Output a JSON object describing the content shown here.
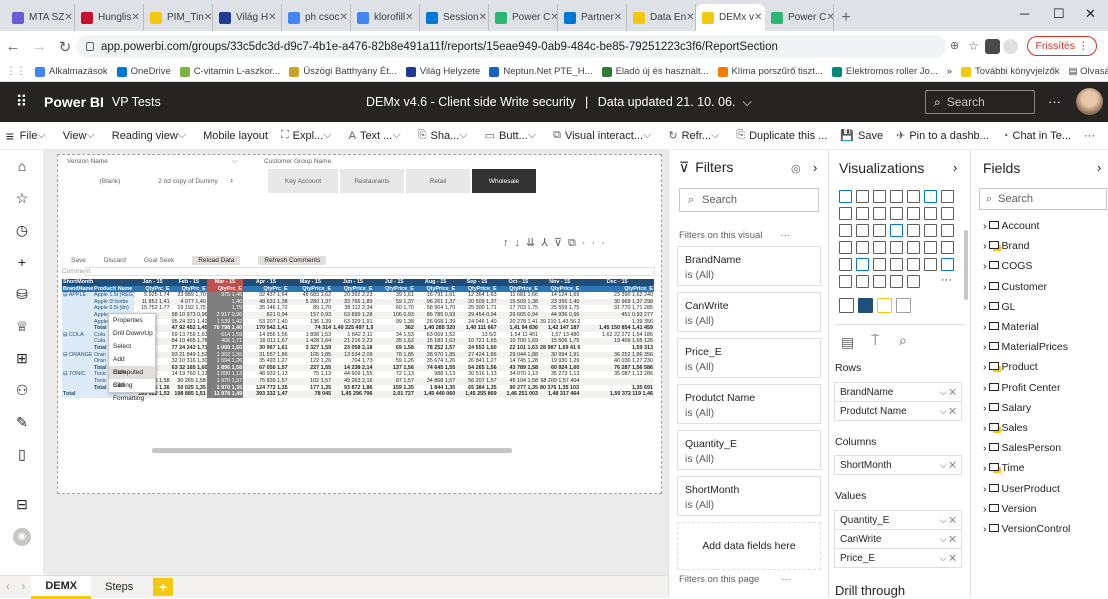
{
  "browser": {
    "tabs": [
      {
        "label": "MTA SZ",
        "color": "#6b5bd6"
      },
      {
        "label": "Hunglis",
        "color": "#c8102e"
      },
      {
        "label": "PIM_Tin",
        "color": "#f2c811"
      },
      {
        "label": "Világ H",
        "color": "#1f3a93"
      },
      {
        "label": "ph csoc",
        "color": "#4285f4"
      },
      {
        "label": "klorofill",
        "color": "#4285f4"
      },
      {
        "label": "Session",
        "color": "#0078d4"
      },
      {
        "label": "Power C",
        "color": "#2bb673"
      },
      {
        "label": "Partner",
        "color": "#0078d4"
      },
      {
        "label": "Data En",
        "color": "#f2c811"
      },
      {
        "label": "DEMx v",
        "color": "#f2c811",
        "active": true
      },
      {
        "label": "Power C",
        "color": "#2bb673"
      }
    ],
    "url": "app.powerbi.com/groups/33c5dc3d-d9c7-4b1e-a476-82b8e491a11f/reports/15eae949-0ab9-484c-be85-79251223c3f6/ReportSection",
    "refresh_label": "Frissítés",
    "bookmarks": [
      {
        "label": "Alkalmazások",
        "color": "#4285f4"
      },
      {
        "label": "OneDrive",
        "color": "#0078d4"
      },
      {
        "label": "C-vitamin L-aszkor...",
        "color": "#7cb342"
      },
      {
        "label": "Üszögi Batthyány Ét...",
        "color": "#c9a227"
      },
      {
        "label": "Világ Helyzete",
        "color": "#1f3a93"
      },
      {
        "label": "Neptun.Net PTE_H...",
        "color": "#1565c0"
      },
      {
        "label": "Eladó új és használt...",
        "color": "#2e7d32"
      },
      {
        "label": "Klíma porszűrő tiszt...",
        "color": "#f57c00"
      },
      {
        "label": "Elektromos roller Jo...",
        "color": "#00897b"
      }
    ],
    "bookmarks_more": "»",
    "other_bookmarks": "További könyvjelzők",
    "reading_list": "Olvasási lista"
  },
  "pbi": {
    "app_name": "Power BI",
    "workspace": "VP Tests",
    "report_title": "DEMx v4.6 - Client side Write security",
    "separator": "|",
    "updated": "Data updated 21. 10. 06.",
    "search_placeholder": "Search",
    "more": "···"
  },
  "toolbar": [
    "File",
    "View",
    "Reading view",
    "Mobile layout",
    "Expl...",
    "Text ...",
    "Sha...",
    "Butt...",
    "Visual interact...",
    "Refr...",
    "Duplicate this ...",
    "Save",
    "Pin to a dashb...",
    "Chat in Te...",
    "···"
  ],
  "slicers": {
    "version_label": "Version Name",
    "version_items": [
      "(Blank)",
      "2 nd copy of Dummy"
    ],
    "customer_label": "Customer Group Name",
    "customer_items": [
      "Key Account",
      "Restaurants",
      "Retail",
      "Wholesale"
    ]
  },
  "matrix_toolbar": {
    "buttons": [
      "Save",
      "Discard",
      "Goal Seek",
      "Reload Data",
      "Refresh Comments"
    ],
    "comment": "Comment"
  },
  "matrix": {
    "col_header_row1": [
      "ShortMonth",
      "Jan - 15",
      "Feb - 15",
      "Mar - 15",
      "Apr - 15",
      "May - 15",
      "Jun - 15",
      "Jul - 15",
      "Aug - 15",
      "Sep - 15",
      "Oct - 15",
      "Nov - 15",
      "Dec - 15"
    ],
    "col_header_row2": [
      "BrandName",
      "Productt Name",
      "QtyPrc_E",
      "QtyPrc_E",
      "QtyPrc_E",
      "QtyPrc_E",
      "QtyPrice_E",
      "QtyPrice_E",
      "QtyPrice_E",
      "QtyPrice_E",
      "QtyPrice_E",
      "QtyPrice_E",
      "QtyPrice_E",
      "QtyPrice_E"
    ],
    "rows": [
      [
        "APPLE",
        "Apple 1.5l (REG)",
        "5 925 1,74",
        "33 889 1,70",
        "975 1,46",
        "32 437 1,64",
        "48 683 1,62",
        "20 392 2,23",
        "39 1,61",
        "16 791 1,61",
        "12 364 1,63",
        "11 681 1,66",
        "14 124 1,69",
        "23 390 1,62 240"
      ],
      [
        "",
        "Apple 0l bottle",
        "11 851 1,41",
        "4 077 1,40",
        "1,40",
        "48 631 1,38",
        "5 280 1,37",
        "33 766 1,89",
        "59 1,37",
        "96 261 1,37",
        "20 509 1,37",
        "15 509 1,38",
        "23 356 1,40",
        "30 969 1,37 298"
      ],
      [
        "",
        "Apple 0.5l (tin)",
        "15 752 1,77",
        "19 192 1,75",
        "1,75",
        "35 146 1,72",
        "89 1,70",
        "38 112 2,34",
        "60 1,70",
        "58 904 1,70",
        "25 300 1,71",
        "17 703 1,75",
        "25 559 1,75",
        "31 770 1,71 285"
      ],
      [
        "",
        "Apple",
        "",
        "98 10 973 0,96",
        "2 917 0,96",
        "821 0,94",
        "157 0,93",
        "63 899 1,28",
        "106 0,93",
        "86 785 0,93",
        "29 454 0,94",
        "29 665 0,94",
        "44 936 0,96",
        "451 0,93 277"
      ],
      [
        "",
        "Apple",
        "",
        "95 24 321 1,42",
        "1 539 1,42",
        "53 207 1,40",
        "136 1,39",
        "63 329 1,91",
        "99 1,38",
        "26 668 1,39",
        "24 046 1,40",
        "20 278 1,41",
        "39 210 1,43 56 274",
        "1,39 356"
      ],
      [
        "",
        "Total",
        "",
        "47 92 452 1,45",
        "70 798 1,40",
        "170 542 1,41",
        "74 314",
        "1,40 225 497 1,93",
        "362",
        "1,40 285 320",
        "1,40 111 667",
        "1,41 94 836",
        "1,42 147 187",
        "1,45 150 854 1,41 459"
      ],
      [
        "COLA",
        "Cola",
        "",
        "69 13 759 1,63",
        "614 1,59",
        "14 956 1,56",
        "1 898 1,53",
        "1 842 2,11",
        "34 1,53",
        "63 069 1,52",
        "13 5/2",
        "1,54 11 401",
        "1,57 13 480",
        "1,62 22 272 1,54 186"
      ],
      [
        "",
        "Cola",
        "",
        "84 10 465 1,78",
        "406 1,71",
        "16 011 1,67",
        "1 428 1,64",
        "21 216 2,23",
        "35 1,63",
        "15 183 1,63",
        "10 721 1,65",
        "10 700 1,69",
        "15 506 1,75",
        "19 409 1,65 126"
      ],
      [
        "",
        "Total",
        "",
        "77 24 243 1,71",
        "1 000 1,60",
        "30 967 1,61",
        "3 327 1,59",
        "23 058 2,18",
        "69 1,58",
        "78 252 1,57",
        "24 553 1,60",
        "22 101 1,63",
        "28 987 1,69 41 681",
        "1,59 313"
      ],
      [
        "ORANGE",
        "Oran",
        "",
        "93 21 849 1,52",
        "1 302 1,55",
        "31 557 1,86",
        "105 1,85",
        "13 534 2,09",
        "78 1,85",
        "38 970 1,85",
        "27 424 1,86",
        "29 044 1,88",
        "30 994 1,91",
        "36 252 1,86 356"
      ],
      [
        "",
        "Oran",
        "",
        "32 10 316 1,30",
        "1 594 1,26",
        "35 493 1,27",
        "122 1,26",
        "704 1,73",
        "59 1,26",
        "35 674 1,26",
        "26 841 1,27",
        "14 745 1,28",
        "19 930 1,29",
        "40 036 1,27 230"
      ],
      [
        "",
        "Total",
        "",
        "63 32 165 1,60",
        "1 896 1,58",
        "67 050 1,57",
        "227 1,55",
        "14 238 2,14",
        "137 1,56",
        "74 645 1,55",
        "54 265 1,56",
        "43 789 1,58",
        "60 924 1,60",
        "76 287 1,56 586"
      ],
      [
        "TONIC",
        "Tonic 0,5l",
        "",
        "14 19 760 1,13",
        "1 000 1,13",
        "48 933 1,13",
        "75 1,13",
        "44 609 1,55",
        "72 1,13",
        "988 1,13",
        "30 516 1,13",
        "34 070 1,13",
        "35 273 1,13",
        "35 087 1,13 286"
      ],
      [
        "",
        "Tonic 0,5l",
        "10 975 1,58",
        "30 265 1,58",
        "1 970 1,57",
        "75 839 1,57",
        "102 1,57",
        "49 263 2,16",
        "87 1,57",
        "34 868 1,57",
        "56 207 1,57",
        "45 104 1,58",
        "68 209 1,57 404",
        ""
      ],
      [
        "",
        "Total",
        "21 946 1,36",
        "50 025 1,35",
        "1 970 1,35",
        "124 772 1,35",
        "177 1,35",
        "93 872 1,86",
        "159 1,35",
        "1 844 1,35",
        "65 384 1,35",
        "90 277 1,35",
        "80 376 1,35 103 296",
        "1,35 691"
      ],
      [
        "Total",
        "",
        "163 022 1,53",
        "198 885 1,51",
        "11 978 1,49",
        "393 332 1,47",
        "78 045",
        "1,45 296 796",
        "2,01 727",
        "1,45 440 060",
        "1,45 255 869",
        "1,46 251 003",
        "1,48 317 464",
        "1,50 372 119 1,46"
      ]
    ],
    "context_menu": [
      "Properties",
      "Drill Down/Up",
      "Select",
      "Add Computed Sibling",
      "Hide",
      "Cell Formatting"
    ]
  },
  "page_tabs": [
    "DEMX",
    "Steps"
  ],
  "add_page": "+",
  "filters": {
    "title": "Filters",
    "search": "Search",
    "on_visual": "Filters on this visual",
    "cards": [
      {
        "name": "BrandName",
        "state": "is (All)"
      },
      {
        "name": "CanWrite",
        "state": "is (All)"
      },
      {
        "name": "Price_E",
        "state": "is (All)"
      },
      {
        "name": "Produtct Name",
        "state": "is (All)"
      },
      {
        "name": "Quantity_E",
        "state": "is (All)"
      },
      {
        "name": "ShortMonth",
        "state": "is (All)"
      }
    ],
    "add_fields": "Add data fields here",
    "on_page": "Filters on this page"
  },
  "visualizations": {
    "title": "Visualizations",
    "rows_label": "Rows",
    "rows": [
      "BrandName",
      "Produtct Name"
    ],
    "columns_label": "Columns",
    "columns": [
      "ShortMonth"
    ],
    "values_label": "Values",
    "values": [
      "Quantity_E",
      "CanWrite",
      "Price_E"
    ],
    "drill": "Drill through"
  },
  "fields": {
    "title": "Fields",
    "search": "Search",
    "items": [
      {
        "name": "Account",
        "yellow": false
      },
      {
        "name": "Brand",
        "yellow": true
      },
      {
        "name": "COGS",
        "yellow": false
      },
      {
        "name": "Customer",
        "yellow": false
      },
      {
        "name": "GL",
        "yellow": false
      },
      {
        "name": "Material",
        "yellow": false
      },
      {
        "name": "MaterialPrices",
        "yellow": false
      },
      {
        "name": "Product",
        "yellow": true
      },
      {
        "name": "Profit Center",
        "yellow": false
      },
      {
        "name": "Salary",
        "yellow": false
      },
      {
        "name": "Sales",
        "yellow": true
      },
      {
        "name": "SalesPerson",
        "yellow": false
      },
      {
        "name": "Time",
        "yellow": true
      },
      {
        "name": "UserProduct",
        "yellow": false
      },
      {
        "name": "Version",
        "yellow": false
      },
      {
        "name": "VersionControl",
        "yellow": false
      }
    ]
  }
}
